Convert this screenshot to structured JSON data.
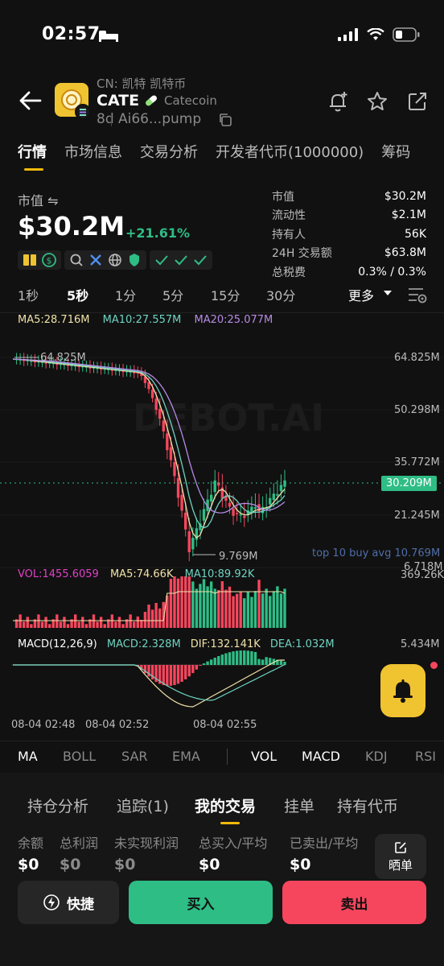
{
  "status_bar": {
    "time": "02:57"
  },
  "header": {
    "cn_name": "CN: 凯特 凯特币",
    "ticker": "CATE",
    "full_name": "Catecoin",
    "age": "8d",
    "address": "Ai66...pump"
  },
  "tabs": [
    "行情",
    "市场信息",
    "交易分析",
    "开发者代币(1000000)",
    "筹码"
  ],
  "market": {
    "label": "市值 ⇋",
    "value": "$30.2M",
    "change": "+21.61%"
  },
  "stats": [
    {
      "k": "市值",
      "v": "$30.2M"
    },
    {
      "k": "流动性",
      "v": "$2.1M"
    },
    {
      "k": "持有人",
      "v": "56K"
    },
    {
      "k": "24H 交易额",
      "v": "$63.8M"
    },
    {
      "k": "总税费",
      "v": "0.3% / 0.3%"
    }
  ],
  "intervals": {
    "items": [
      "1秒",
      "5秒",
      "1分",
      "5分",
      "15分",
      "30分"
    ],
    "more": "更多"
  },
  "chart": {
    "watermark": "DEBOT.AI",
    "ma": {
      "ma5": "MA5:28.716M",
      "ma10": "MA10:27.557M",
      "ma20": "MA20:25.077M"
    },
    "price_axis": [
      "64.825M",
      "50.298M",
      "35.772M",
      "21.245M",
      "6.718M"
    ],
    "current_price": "30.209M",
    "high_label": "64.825M",
    "low_label": "9.769M",
    "avg_note": "top 10 buy avg 10.769M",
    "vol": {
      "vol": "VOL:1455.6059",
      "ma5": "MA5:74.66K",
      "ma10": "MA10:89.92K",
      "max": "369.26K"
    },
    "macd": {
      "label": "MACD(12,26,9)",
      "macd": "MACD:2.328M",
      "dif": "DIF:132.141K",
      "dea": "DEA:1.032M",
      "max": "5.434M"
    },
    "x_labels": [
      "08-04 02:48",
      "08-04 02:52",
      "08-04 02:55"
    ]
  },
  "indicators": [
    "MA",
    "BOLL",
    "SAR",
    "EMA",
    "VOL",
    "MACD",
    "KDJ",
    "RSI"
  ],
  "panel": {
    "tabs": [
      "持仓分析",
      "追踪(1)",
      "我的交易",
      "挂单",
      "持有代币"
    ],
    "columns": [
      {
        "label": "余额",
        "value": "$0"
      },
      {
        "label": "总利润",
        "value": "$0"
      },
      {
        "label": "未实现利润",
        "value": "$0"
      },
      {
        "label": "总买入/平均",
        "value": "$0"
      },
      {
        "label": "已卖出/平均",
        "value": "$0"
      }
    ],
    "share": "晒单"
  },
  "actions": {
    "quick": "快捷",
    "buy": "买入",
    "sell": "卖出"
  },
  "colors": {
    "up": "#2ebd85",
    "down": "#f6465d",
    "accent": "#f0b90b",
    "ma5": "#f0e2a8",
    "ma10": "#6fd3c1",
    "ma20": "#b78be6",
    "vol": "#e040c8"
  }
}
